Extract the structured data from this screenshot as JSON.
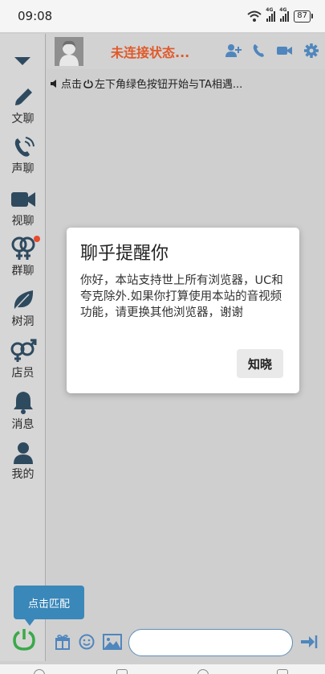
{
  "status_bar": {
    "time": "09:08",
    "battery": "87",
    "network_labels": [
      "4G",
      "4G"
    ]
  },
  "header": {
    "title": "未连接状态..."
  },
  "sidebar": {
    "items": [
      {
        "label": "文聊",
        "icon": "pencil-icon"
      },
      {
        "label": "声聊",
        "icon": "phone-icon"
      },
      {
        "label": "视聊",
        "icon": "video-camera-icon"
      },
      {
        "label": "群聊",
        "icon": "gender-group-icon",
        "badge": true
      },
      {
        "label": "树洞",
        "icon": "leaf-icon"
      },
      {
        "label": "店员",
        "icon": "gender-icon"
      },
      {
        "label": "消息",
        "icon": "bell-icon"
      },
      {
        "label": "我的",
        "icon": "user-icon"
      }
    ]
  },
  "notice": {
    "text_before": "点击",
    "text_after": "左下角绿色按钮开始与TA相遇..."
  },
  "dialog": {
    "title": "聊乎提醒你",
    "message": "你好，本站支持世上所有浏览器，UC和夸克除外.如果你打算使用本站的音视频功能，请更换其他浏览器，谢谢",
    "ok_label": "知晓"
  },
  "match_button": {
    "label": "点击匹配"
  },
  "colors": {
    "accent": "#3a87b9",
    "title": "#e05a2b",
    "power": "#3aa94a",
    "icon": "#2e4a5f",
    "badge": "#e84a2f"
  }
}
